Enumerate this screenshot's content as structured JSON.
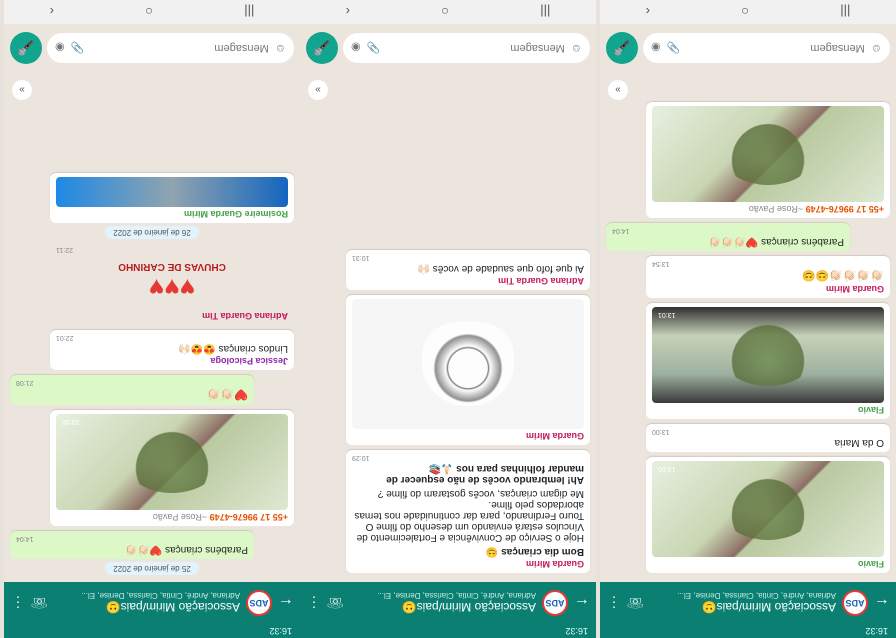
{
  "header": {
    "title": "Associação Mirim/pais🙂",
    "members": "Adriana, André, Cintia, Clarissa, Denise, El...",
    "avatar_text": "ADS",
    "status_time": "16:32"
  },
  "composer": {
    "placeholder": "Mensagem"
  },
  "strip1": {
    "messages": [
      {
        "sender": "Flavio",
        "photo_time": "13:00"
      },
      {
        "text": "O da Maria",
        "time": "13:00"
      },
      {
        "sender": "Flavio",
        "photo_time": "13:01"
      },
      {
        "sender": "Guarda Mirim",
        "text": "👏🏻👏🏻👏🏻👏🏻😊😊",
        "time": "13:54"
      },
      {
        "text": "Parabéns crianças ❤️👏🏻👏🏻👏🏻",
        "time": "14:04"
      },
      {
        "phone": "+55 17 99676-4749",
        "name": "~Rose Pavão"
      }
    ]
  },
  "strip2": {
    "messages": [
      {
        "sender": "Guarda Mirim",
        "title": "Bom dia crianças 😊",
        "body": "Hoje o Serviço de Convivência e Fortalecimento de Vínculos estará enviando um desenho do filme O Touro Ferdinando, para dar continuidade nos temas abordados pelo filme.\nMe digam crianças, vocês gostaram do filme ?",
        "footer": "Ah! lembrando vocês de não esquecer de mandar folhinhas para nos 🙏🏻📚",
        "time": "10:29"
      },
      {
        "sender": "Guarda Mirim",
        "photo_time": ""
      },
      {
        "sender": "Adriana Guarda Tim",
        "text": "Ai que fofo que saudade de vocês 🙌🏻",
        "time": "10:31"
      }
    ]
  },
  "strip3": {
    "messages": [
      {
        "date": "25 de janeiro de 2022"
      },
      {
        "text": "Parabéns crianças ❤️👏🏻👏🏻",
        "time": "14:04"
      },
      {
        "phone": "+55 17 99676-4749",
        "name": "~Rose Pavão",
        "photo_time": "20:56"
      },
      {
        "text": "❤️👏🏻👏🏻",
        "time": "21:08"
      },
      {
        "sender": "Jessica Psicologa",
        "text": "Lindos crianças 😍😍🙌🏻",
        "time": "22:01"
      },
      {
        "sender": "Adriana Guarda Tim",
        "sticker": "CHUVAS DE CARINHO",
        "time": "22:11"
      },
      {
        "date": "26 de janeiro de 2022"
      },
      {
        "sender": "Rosimeire Guarda Mirim"
      }
    ]
  }
}
